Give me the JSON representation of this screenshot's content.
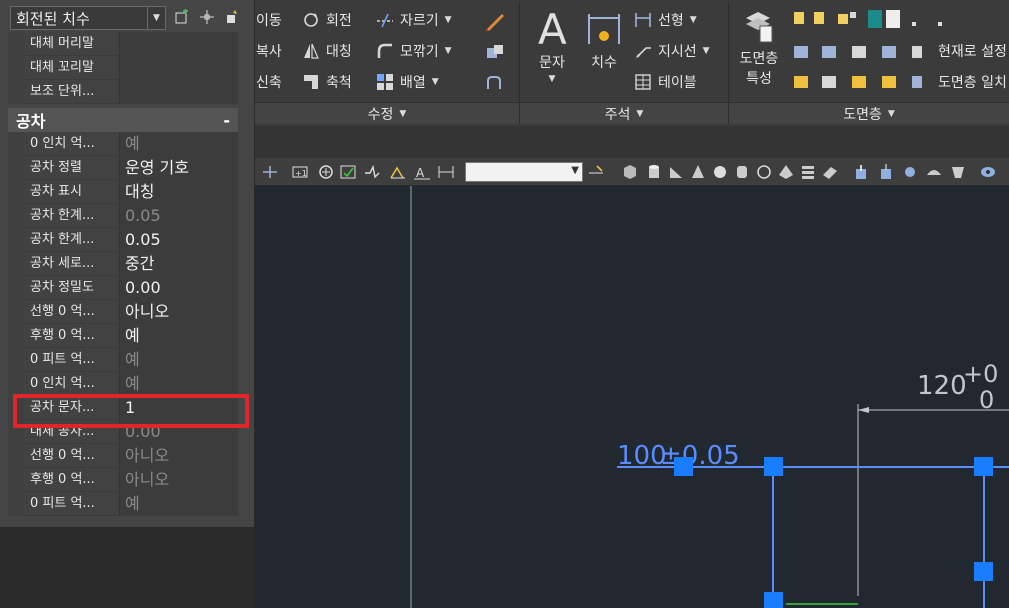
{
  "ribbon": {
    "modify": {
      "move": "이동",
      "rotate": "회전",
      "trim": "자르기",
      "copy": "복사",
      "mirror": "대칭",
      "fillet": "모깎기",
      "stretch": "신축",
      "scale": "축척",
      "array": "배열",
      "panel_title": "수정"
    },
    "annotation": {
      "text": "문자",
      "dimension": "치수",
      "linear": "선형",
      "leader": "지시선",
      "table": "테이블",
      "panel_title": "주석"
    },
    "layers": {
      "properties_line1": "도면층",
      "properties_line2": "특성",
      "make_current": "현재로 설정",
      "match": "도면층 일치",
      "panel_title": "도면층"
    }
  },
  "properties": {
    "selector_value": "회전된 치수",
    "top_rows": [
      {
        "name": "대체 머리말",
        "value": ""
      },
      {
        "name": "대체 꼬리말",
        "value": ""
      },
      {
        "name": "보조 단위...",
        "value": ""
      }
    ],
    "section_title": "공차",
    "section_collapse": "-",
    "rows": [
      {
        "name": "0 인치 억...",
        "value": "예",
        "dim": true
      },
      {
        "name": "공차 정렬",
        "value": "운영 기호",
        "dim": false
      },
      {
        "name": "공차 표시",
        "value": "대칭",
        "dim": false
      },
      {
        "name": "공차 한계...",
        "value": "0.05",
        "dim": true
      },
      {
        "name": "공차 한계...",
        "value": "0.05",
        "dim": false
      },
      {
        "name": "공차 세로...",
        "value": "중간",
        "dim": false
      },
      {
        "name": "공차 정밀도",
        "value": "0.00",
        "dim": false
      },
      {
        "name": "선행 0 억...",
        "value": "아니오",
        "dim": false
      },
      {
        "name": "후행 0 억...",
        "value": "예",
        "dim": false
      },
      {
        "name": "0 피트 억...",
        "value": "예",
        "dim": true
      },
      {
        "name": "0 인치 억...",
        "value": "예",
        "dim": true
      },
      {
        "name": "공차 문자...",
        "value": "1",
        "dim": false
      },
      {
        "name": "대체 공차...",
        "value": "0.00",
        "dim": true
      },
      {
        "name": "선행 0 억...",
        "value": "아니오",
        "dim": true
      },
      {
        "name": "후행 0 억...",
        "value": "아니오",
        "dim": true
      },
      {
        "name": "0 피트 억...",
        "value": "예",
        "dim": true
      }
    ]
  },
  "drawing": {
    "dim1_base": "100",
    "dim1_tol": "±0.05",
    "dim2_base": "120",
    "dim2_upper": "+0",
    "dim2_lower": "0"
  },
  "colors": {
    "highlight": "#e0252b",
    "grip": "#1a7cff",
    "dim_line": "#5b8cff"
  }
}
